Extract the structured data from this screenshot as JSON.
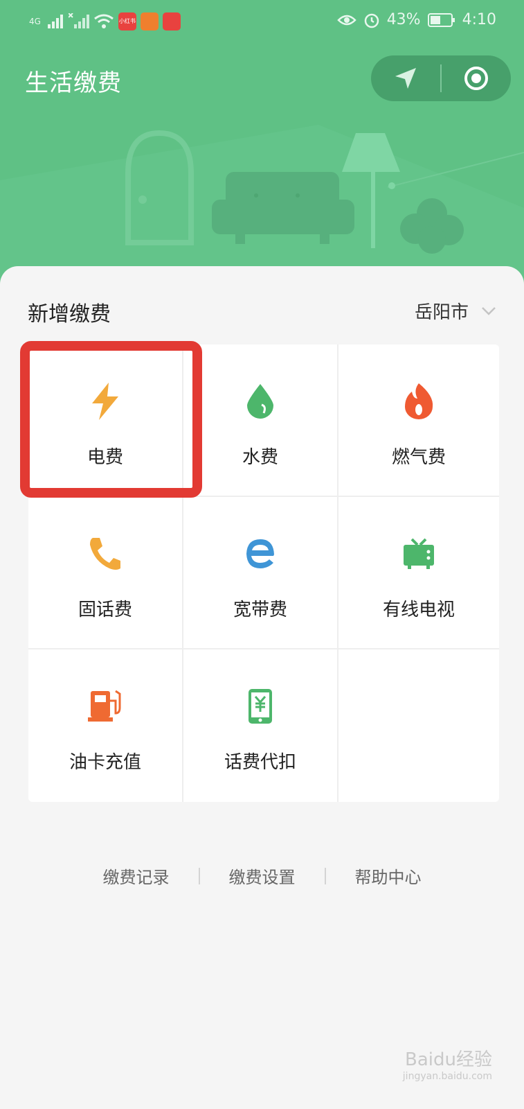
{
  "status_bar": {
    "network": "4G",
    "battery": "43%",
    "time": "4:10",
    "badge_label": "小红书",
    "colors": {
      "badge_red": "#e8423f",
      "badge_orange": "#ef7f2e",
      "badge_red2": "#e8423f"
    }
  },
  "header": {
    "title": "生活缴费",
    "background": "#5fc185",
    "capsule_icons": [
      "location-arrow-icon",
      "record-target-icon"
    ]
  },
  "main": {
    "section_title": "新增缴费",
    "city": "岳阳市",
    "services": [
      {
        "label": "电费",
        "icon": "lightning-icon",
        "color": "#f2a93b",
        "highlighted": true
      },
      {
        "label": "水费",
        "icon": "water-drop-icon",
        "color": "#4db66b"
      },
      {
        "label": "燃气费",
        "icon": "flame-icon",
        "color": "#ef5a32"
      },
      {
        "label": "固话费",
        "icon": "phone-icon",
        "color": "#f2a93b"
      },
      {
        "label": "宽带费",
        "icon": "broadband-e-icon",
        "color": "#3f95d6"
      },
      {
        "label": "有线电视",
        "icon": "tv-icon",
        "color": "#4db66b"
      },
      {
        "label": "油卡充值",
        "icon": "fuel-pump-icon",
        "color": "#ef6a32"
      },
      {
        "label": "话费代扣",
        "icon": "phone-yuan-icon",
        "color": "#4db66b"
      },
      {
        "label": "",
        "icon": ""
      }
    ],
    "highlight_color": "#e23a33"
  },
  "footer": {
    "links": [
      "缴费记录",
      "缴费设置",
      "帮助中心"
    ]
  },
  "watermark": {
    "text": "Baidu经验",
    "sub": "jingyan.baidu.com"
  }
}
